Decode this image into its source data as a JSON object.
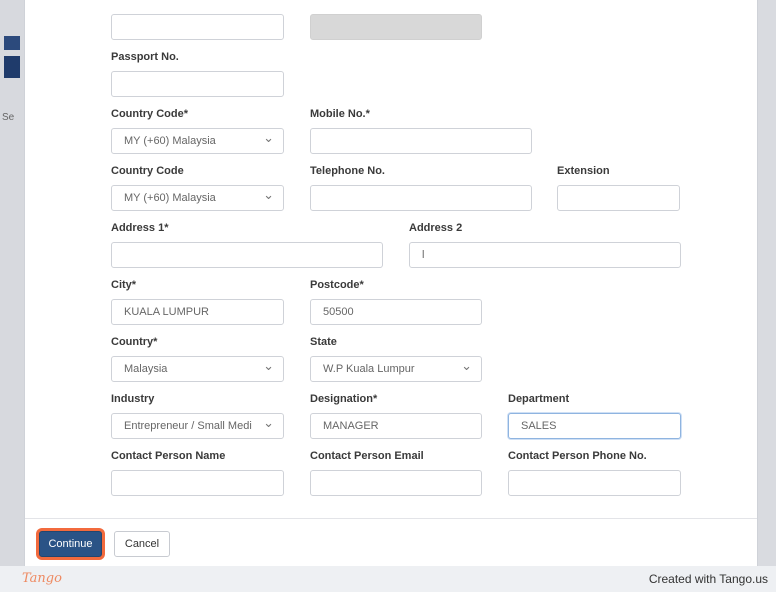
{
  "credit": "Created with Tango.us",
  "tango_logo": "Tango",
  "bg": {
    "left_hint": "Se"
  },
  "form": {
    "passport_label": "Passport No.",
    "passport_value": "",
    "country_code_req_label": "Country Code*",
    "country_code_req_value": "MY  (+60)  Malaysia",
    "mobile_label": "Mobile No.*",
    "mobile_value": "",
    "country_code_label": "Country Code",
    "country_code_value": "MY  (+60)  Malaysia",
    "telephone_label": "Telephone No.",
    "telephone_value": "",
    "extension_label": "Extension",
    "extension_value": "",
    "address1_label": "Address 1*",
    "address1_value": "",
    "address2_label": "Address 2",
    "address2_value": "l",
    "city_label": "City*",
    "city_value": "KUALA LUMPUR",
    "postcode_label": "Postcode*",
    "postcode_value": "50500",
    "country_label": "Country*",
    "country_value": "Malaysia",
    "state_label": "State",
    "state_value": "W.P Kuala Lumpur",
    "industry_label": "Industry",
    "industry_value": "Entrepreneur / Small Medi",
    "designation_label": "Designation*",
    "designation_value": "MANAGER",
    "department_label": "Department",
    "department_value": "SALES",
    "contact_name_label": "Contact Person Name",
    "contact_name_value": "",
    "contact_email_label": "Contact Person Email",
    "contact_email_value": "",
    "contact_phone_label": "Contact Person Phone No.",
    "contact_phone_value": ""
  },
  "buttons": {
    "continue": "Continue",
    "cancel": "Cancel"
  },
  "colors": {
    "primary": "#2a5386",
    "highlight": "#f26a3d",
    "tango": "#ee8a62"
  }
}
